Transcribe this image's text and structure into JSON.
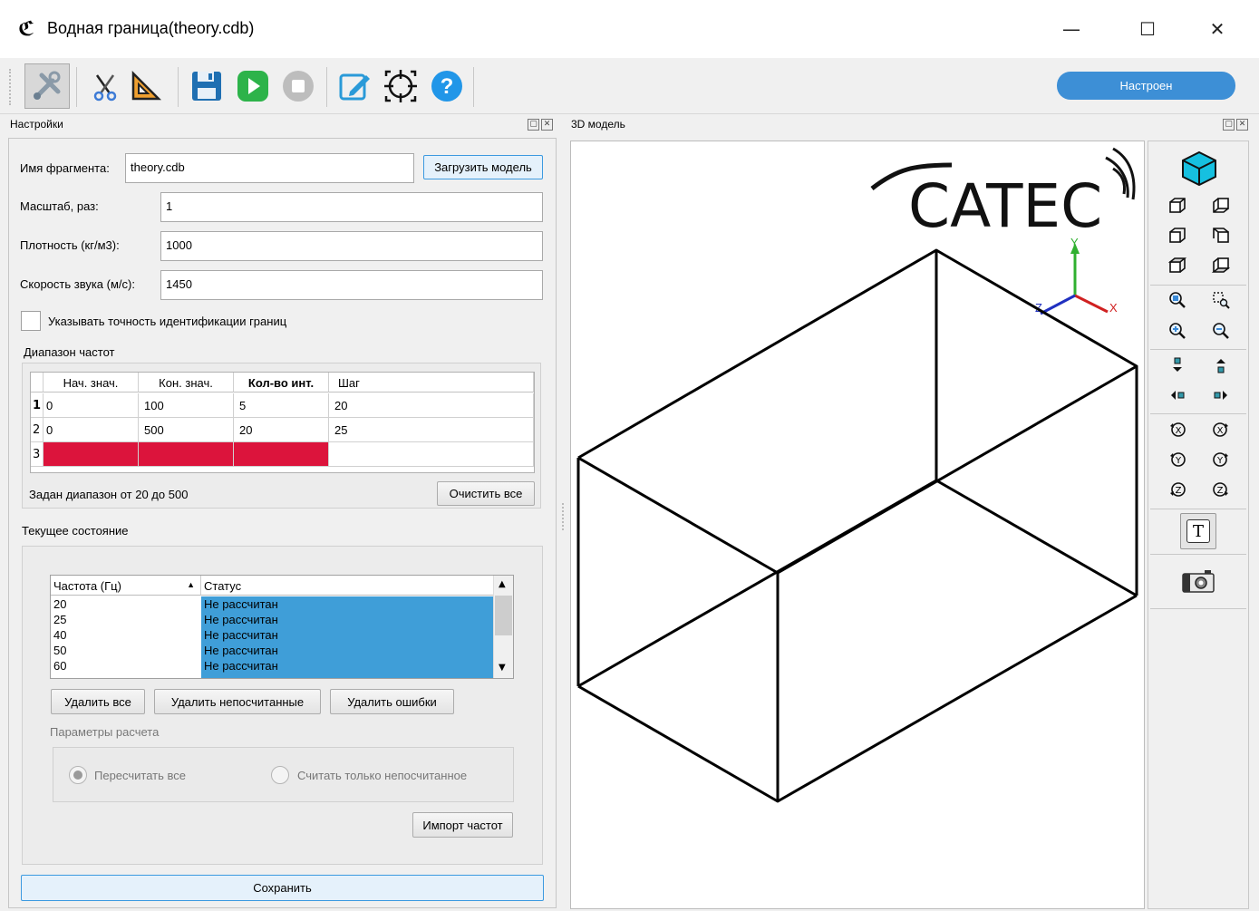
{
  "window": {
    "title": "Водная граница(theory.cdb)",
    "logo_glyph": "ℭ",
    "minimize": "—",
    "maximize": "☐",
    "close": "✕"
  },
  "toolbar": {
    "icons": [
      "settings-tools-icon",
      "scissors-icon",
      "triangle-ruler-icon",
      "save-icon",
      "play-icon",
      "stop-icon",
      "edit-icon",
      "target-icon",
      "help-icon"
    ],
    "status_label": "Настроен",
    "status_color": "#3d8fd6"
  },
  "settings_panel": {
    "title": "Настройки",
    "fragment_label": "Имя фрагмента:",
    "fragment_value": "theory.cdb",
    "load_button": "Загрузить модель",
    "scale_label": "Масштаб, раз:",
    "scale_value": "1",
    "density_label": "Плотность (кг/м3):",
    "density_value": "1000",
    "sound_label": "Скорость звука (м/с):",
    "sound_value": "1450",
    "precision_checkbox_label": "Указывать точность идентификации границ",
    "precision_checked": false,
    "freq_range_title": "Диапазон частот",
    "freq_table": {
      "headers": [
        "Нач. знач.",
        "Кон. знач.",
        "Кол-во инт.",
        "Шаг"
      ],
      "rows": [
        {
          "num": "1",
          "cells": [
            "0",
            "100",
            "5",
            "20"
          ]
        },
        {
          "num": "2",
          "cells": [
            "0",
            "500",
            "20",
            "25"
          ]
        },
        {
          "num": "3",
          "cells": [
            "",
            "",
            "",
            ""
          ]
        }
      ]
    },
    "range_summary": "Задан диапазон от 20 до 500",
    "clear_all_button": "Очистить все",
    "current_state_title": "Текущее состояние",
    "freq_list": {
      "headers": [
        "Частота (Гц)",
        "Статус"
      ],
      "rows": [
        {
          "freq": "20",
          "status": "Не рассчитан"
        },
        {
          "freq": "25",
          "status": "Не рассчитан"
        },
        {
          "freq": "40",
          "status": "Не рассчитан"
        },
        {
          "freq": "50",
          "status": "Не рассчитан"
        },
        {
          "freq": "60",
          "status": "Не рассчитан"
        }
      ]
    },
    "delete_all_button": "Удалить все",
    "delete_uncalculated_button": "Удалить непосчитанные",
    "delete_errors_button": "Удалить ошибки",
    "calc_params_title": "Параметры расчета",
    "recalc_all_radio": "Пересчитать все",
    "calc_uncalculated_radio": "Считать только непосчитанное",
    "selected_radio": "recalc_all",
    "import_button": "Импорт частот",
    "save_button": "Сохранить"
  },
  "model_panel": {
    "title": "3D модель",
    "logo_text": "CATEC",
    "axis_x": "X",
    "axis_y": "Y",
    "axis_z": "Z"
  },
  "view_toolbar": {
    "icons": [
      "iso-cube-icon",
      "view-front-icon",
      "view-back-icon",
      "view-left-icon",
      "view-right-icon",
      "view-top-icon",
      "view-bottom-icon",
      "zoom-fit-icon",
      "zoom-window-icon",
      "zoom-in-icon",
      "zoom-out-icon",
      "pan-down-icon",
      "pan-up-icon",
      "pan-left-icon",
      "pan-right-icon",
      "rotate-x-ccw-icon",
      "rotate-x-cw-icon",
      "rotate-y-ccw-icon",
      "rotate-y-cw-icon",
      "rotate-z-ccw-icon",
      "rotate-z-cw-icon",
      "text-toggle-icon",
      "camera-icon"
    ],
    "text_glyph": "T"
  }
}
